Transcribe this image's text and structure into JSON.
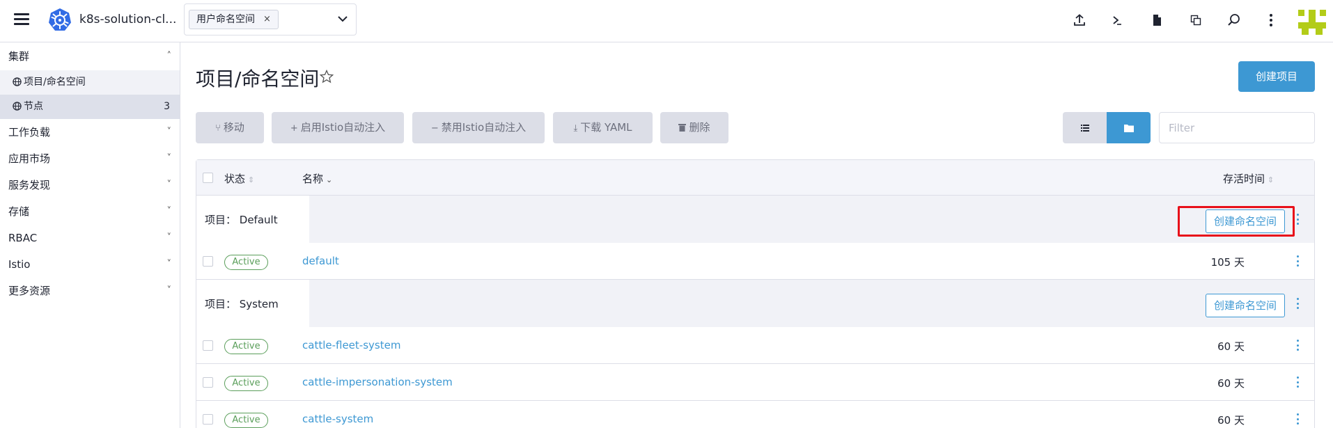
{
  "header": {
    "cluster_name": "k8s-solution-cl...",
    "namespace_chip": "用户命名空间",
    "chip_close": "×",
    "icons": [
      "upload-icon",
      "terminal-icon",
      "file-icon",
      "copy-icon",
      "search-icon",
      "more-vert-icon"
    ]
  },
  "sidebar": {
    "cluster_label": "集群",
    "items": [
      {
        "label": "项目/命名空间",
        "count": ""
      },
      {
        "label": "节点",
        "count": "3"
      }
    ],
    "groups": [
      "工作负载",
      "应用市场",
      "服务发现",
      "存储",
      "RBAC",
      "Istio",
      "更多资源"
    ]
  },
  "main": {
    "title": "项目/命名空间",
    "create_project": "创建项目",
    "toolbar": {
      "move": "移动",
      "enable_istio": "启用Istio自动注入",
      "disable_istio": "禁用Istio自动注入",
      "download_yaml": "下载 YAML",
      "delete": "删除"
    },
    "filter_placeholder": "Filter"
  },
  "table": {
    "headers": {
      "status": "状态",
      "name": "名称",
      "age": "存活时间"
    },
    "groups": [
      {
        "label": "项目： Default",
        "create_ns": "创建命名空间",
        "rows": [
          {
            "status": "Active",
            "name": "default",
            "age": "105 天"
          }
        ]
      },
      {
        "label": "项目： System",
        "create_ns": "创建命名空间",
        "rows": [
          {
            "status": "Active",
            "name": "cattle-fleet-system",
            "age": "60 天"
          },
          {
            "status": "Active",
            "name": "cattle-impersonation-system",
            "age": "60 天"
          },
          {
            "status": "Active",
            "name": "cattle-system",
            "age": "60 天"
          }
        ]
      }
    ]
  },
  "colors": {
    "accent": "#3d98d3",
    "active_green": "#5a9e5a",
    "highlight_red": "#e8101a",
    "avatar_green": "#b3cc18"
  }
}
